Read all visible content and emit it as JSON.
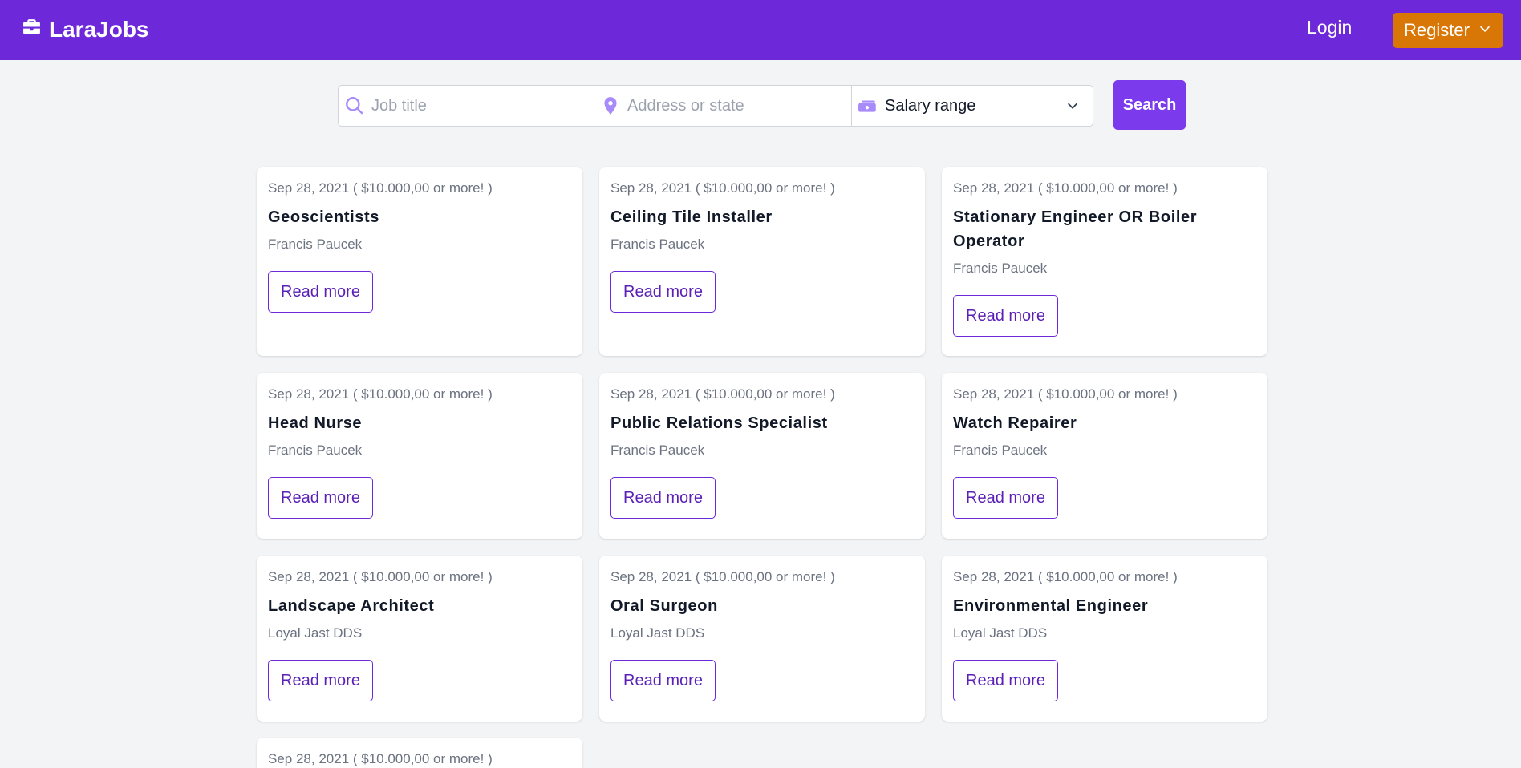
{
  "navbar": {
    "brand": "LaraJobs",
    "login": "Login",
    "register": "Register"
  },
  "search": {
    "job_placeholder": "Job title",
    "address_placeholder": "Address or state",
    "salary_selected": "Salary range",
    "button": "Search"
  },
  "jobs": [
    {
      "meta": "Sep 28, 2021 ( $10.000,00 or more! )",
      "title": "Geoscientists",
      "company": "Francis Paucek",
      "cta": "Read more"
    },
    {
      "meta": "Sep 28, 2021 ( $10.000,00 or more! )",
      "title": "Ceiling Tile Installer",
      "company": "Francis Paucek",
      "cta": "Read more"
    },
    {
      "meta": "Sep 28, 2021 ( $10.000,00 or more! )",
      "title": "Stationary Engineer OR Boiler Operator",
      "company": "Francis Paucek",
      "cta": "Read more"
    },
    {
      "meta": "Sep 28, 2021 ( $10.000,00 or more! )",
      "title": "Head Nurse",
      "company": "Francis Paucek",
      "cta": "Read more"
    },
    {
      "meta": "Sep 28, 2021 ( $10.000,00 or more! )",
      "title": "Public Relations Specialist",
      "company": "Francis Paucek",
      "cta": "Read more"
    },
    {
      "meta": "Sep 28, 2021 ( $10.000,00 or more! )",
      "title": "Watch Repairer",
      "company": "Francis Paucek",
      "cta": "Read more"
    },
    {
      "meta": "Sep 28, 2021 ( $10.000,00 or more! )",
      "title": "Landscape Architect",
      "company": "Loyal Jast DDS",
      "cta": "Read more"
    },
    {
      "meta": "Sep 28, 2021 ( $10.000,00 or more! )",
      "title": "Oral Surgeon",
      "company": "Loyal Jast DDS",
      "cta": "Read more"
    },
    {
      "meta": "Sep 28, 2021 ( $10.000,00 or more! )",
      "title": "Environmental Engineer",
      "company": "Loyal Jast DDS",
      "cta": "Read more"
    },
    {
      "meta": "Sep 28, 2021 ( $10.000,00 or more! )",
      "title": "",
      "company": "",
      "cta": ""
    }
  ],
  "colors": {
    "navbar": "#6d28d9",
    "register": "#d97706",
    "search_button": "#7c3aed",
    "icon_accent": "#a78bfa"
  }
}
